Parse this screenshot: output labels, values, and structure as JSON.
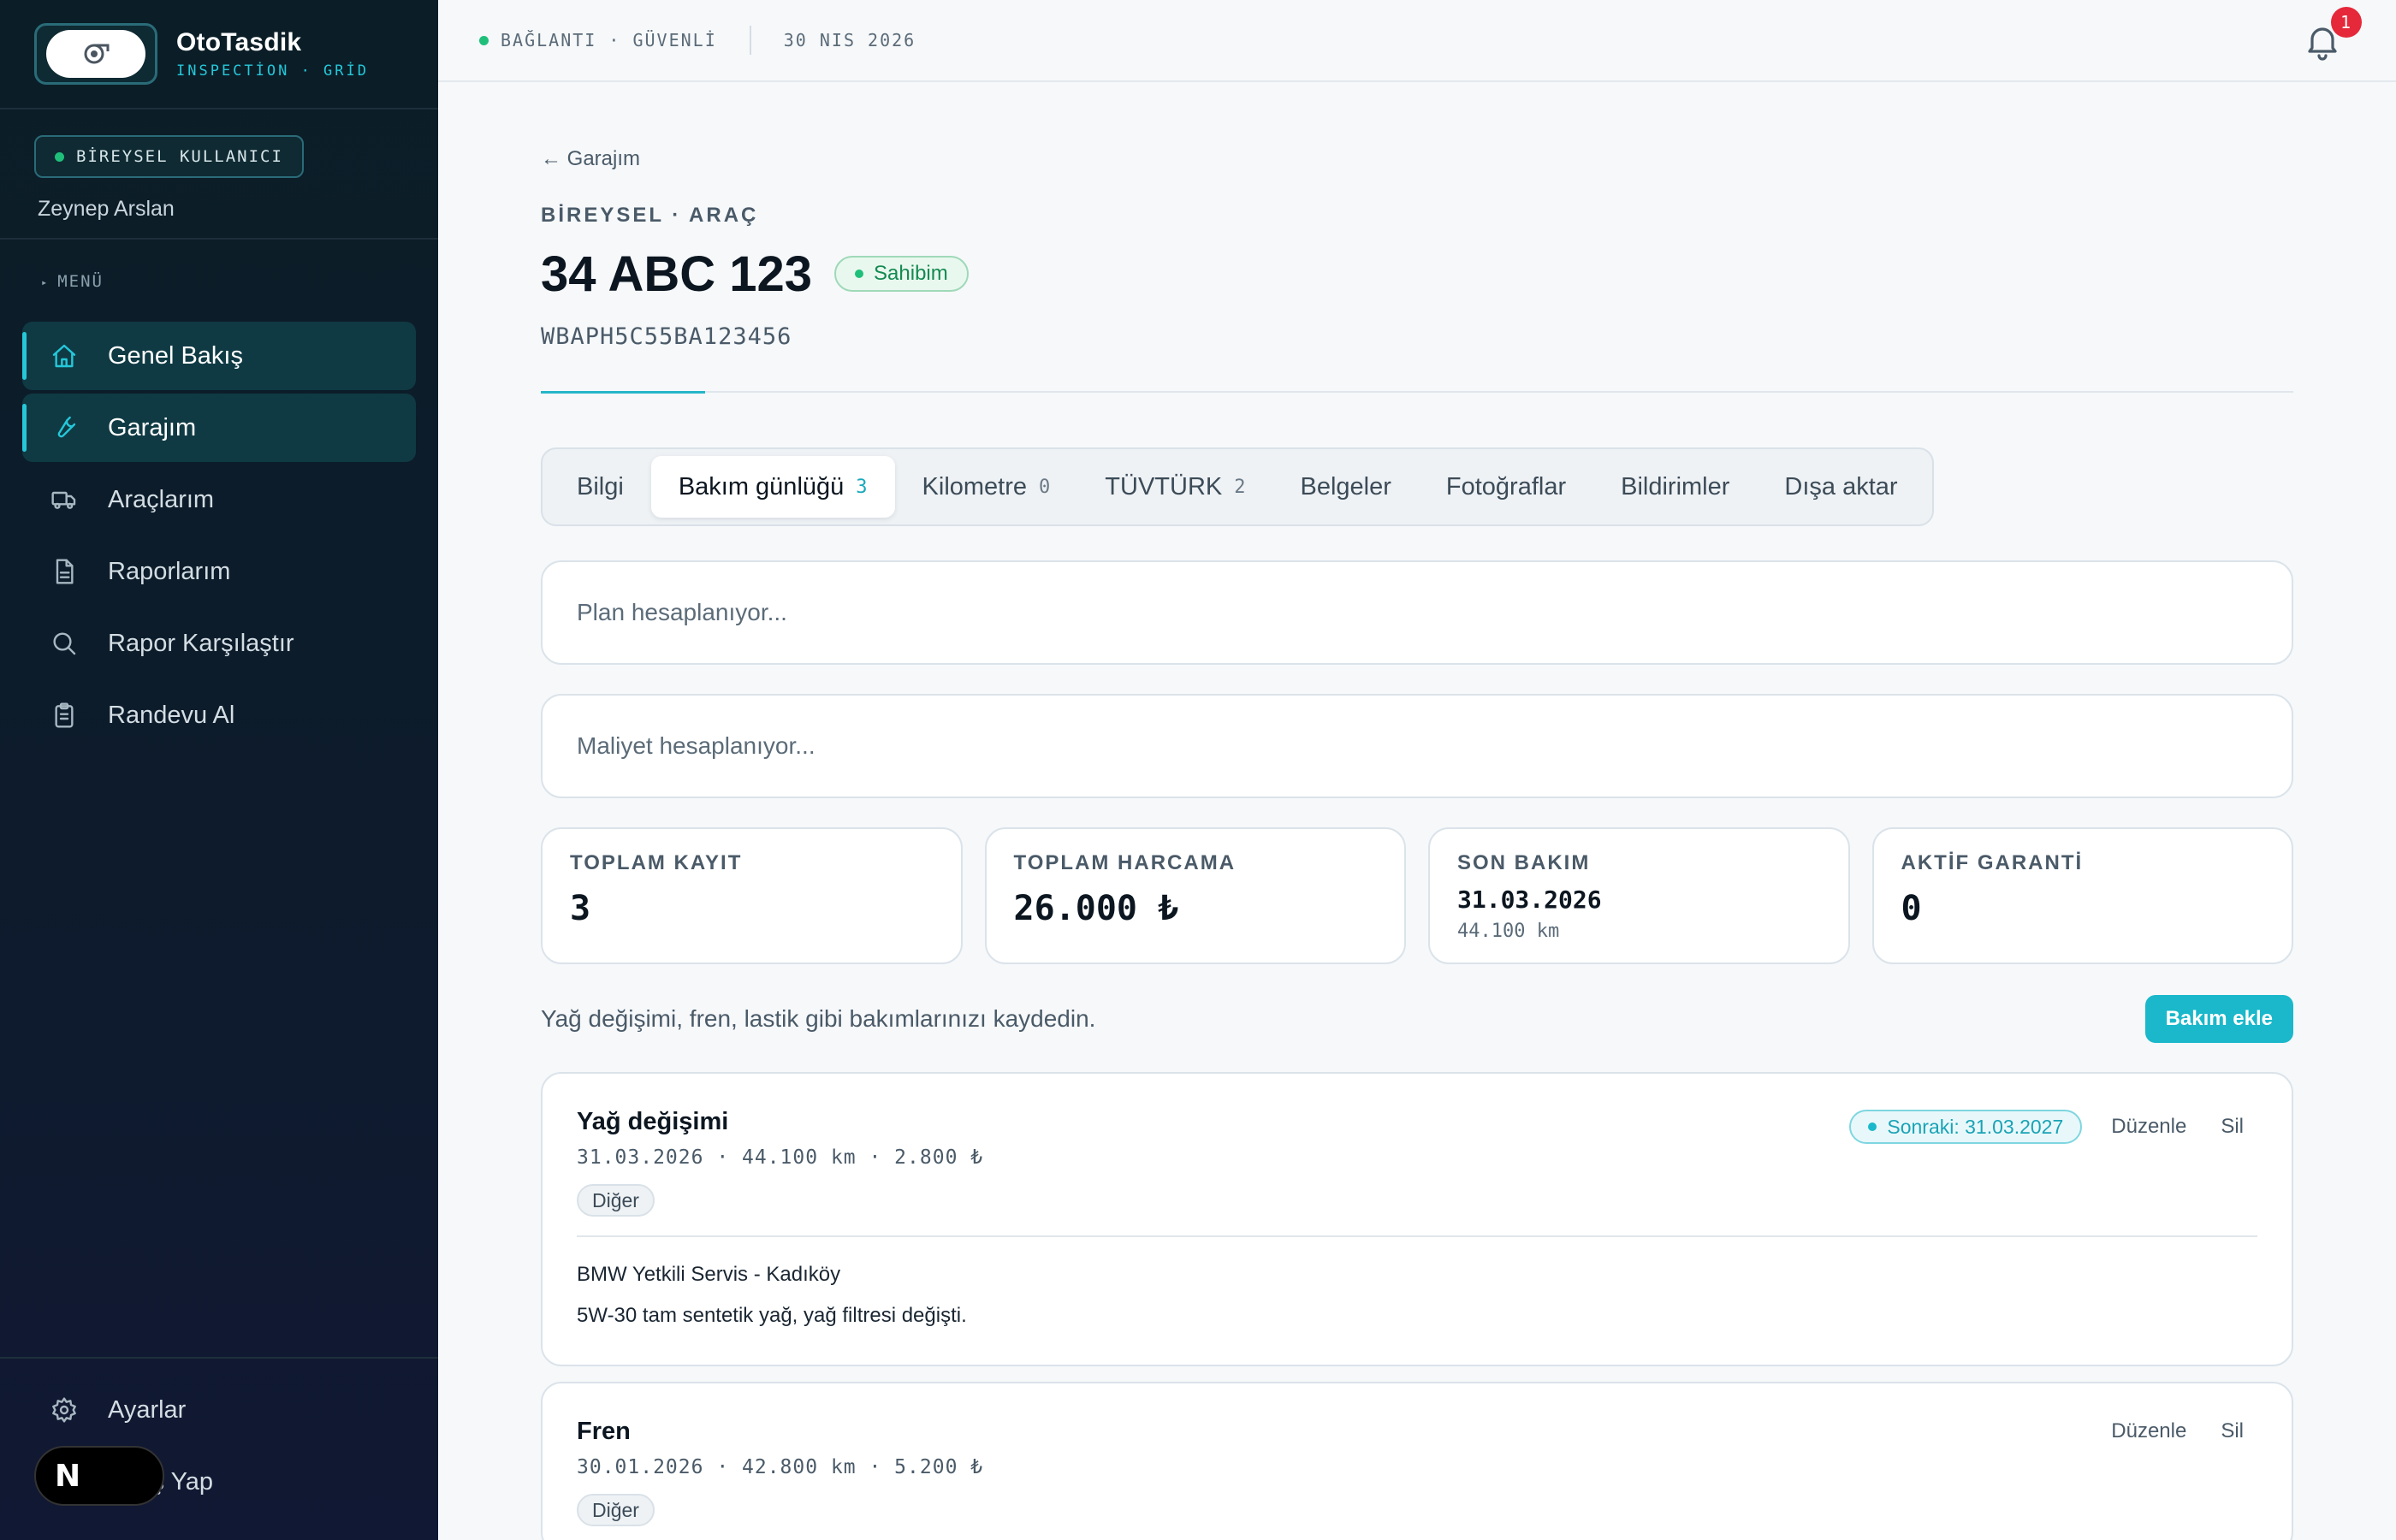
{
  "brand": {
    "name": "OtoTasdik",
    "subtitle": "INSPECTİON · GRİD"
  },
  "user": {
    "role_badge": "BİREYSEL KULLANICI",
    "name": "Zeynep Arslan"
  },
  "menu": {
    "label": "MENÜ",
    "items": [
      {
        "label": "Genel Bakış",
        "icon": "home-icon"
      },
      {
        "label": "Garajım",
        "icon": "wrench-icon"
      },
      {
        "label": "Araçlarım",
        "icon": "truck-icon"
      },
      {
        "label": "Raporlarım",
        "icon": "document-icon"
      },
      {
        "label": "Rapor Karşılaştır",
        "icon": "search-icon"
      },
      {
        "label": "Randevu Al",
        "icon": "clipboard-icon"
      }
    ],
    "bottom": [
      {
        "label": "Ayarlar",
        "icon": "gear-icon"
      },
      {
        "label": "Çıkış Yap",
        "icon": "logout-icon"
      }
    ]
  },
  "topbar": {
    "status": "BAĞLANTI · GÜVENLİ",
    "date": "30 NIS 2026",
    "notification_count": "1"
  },
  "vehicle": {
    "back_label": "← Garajım",
    "eyebrow": "BİREYSEL · ARAÇ",
    "plate": "34 ABC 123",
    "ownership": "Sahibim",
    "vin": "WBAPH5C55BA123456"
  },
  "tabs": [
    {
      "label": "Bilgi",
      "count": ""
    },
    {
      "label": "Bakım günlüğü",
      "count": "3"
    },
    {
      "label": "Kilometre",
      "count": "0"
    },
    {
      "label": "TÜVTÜRK",
      "count": "2"
    },
    {
      "label": "Belgeler",
      "count": ""
    },
    {
      "label": "Fotoğraflar",
      "count": ""
    },
    {
      "label": "Bildirimler",
      "count": ""
    },
    {
      "label": "Dışa aktar",
      "count": ""
    }
  ],
  "active_tab": "Bakım günlüğü",
  "loading": {
    "plan": "Plan hesaplanıyor...",
    "cost": "Maliyet hesaplanıyor..."
  },
  "stats": [
    {
      "label": "TOPLAM KAYIT",
      "value": "3"
    },
    {
      "label": "TOPLAM HARCAMA",
      "value": "26.000 ₺"
    },
    {
      "label": "SON BAKIM",
      "value": "31.03.2026",
      "sub": "44.100 km"
    },
    {
      "label": "AKTİF GARANTİ",
      "value": "0"
    }
  ],
  "hint": "Yağ değişimi, fren, lastik gibi bakımlarınızı kaydedin.",
  "add_button": "Bakım ekle",
  "records": [
    {
      "title": "Yağ değişimi",
      "meta": "31.03.2026 · 44.100 km · 2.800 ₺",
      "tag": "Diğer",
      "next": "Sonraki: 31.03.2027",
      "service": "BMW Yetkili Servis - Kadıköy",
      "note": "5W-30 tam sentetik yağ, yağ filtresi değişti.",
      "edit": "Düzenle",
      "delete": "Sil"
    },
    {
      "title": "Fren",
      "meta": "30.01.2026 · 42.800 km · 5.200 ₺",
      "tag": "Diğer",
      "edit": "Düzenle",
      "delete": "Sil"
    }
  ],
  "colors": {
    "accent": "#1ab8ca",
    "sidebar_bg": "#0b1e27",
    "owner_green": "#138a50",
    "badge_red": "#e5283a"
  }
}
